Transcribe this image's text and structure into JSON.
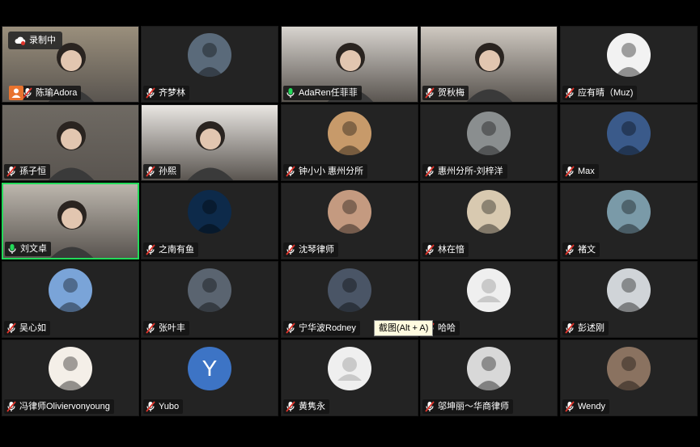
{
  "recording": {
    "label": "录制中"
  },
  "tooltip": {
    "label": "截图(Alt + A)"
  },
  "participants": [
    {
      "name": "陈瑜Adora",
      "muted": true,
      "video": true,
      "bg": "#9a8f7c"
    },
    {
      "name": "齐梦林",
      "muted": true,
      "video": false,
      "avatar_color": "#5a6a7a"
    },
    {
      "name": "AdaRen任菲菲",
      "muted": false,
      "video": true,
      "bg": "#d8d4cf"
    },
    {
      "name": "贺秋梅",
      "muted": true,
      "video": true,
      "bg": "#cfc9c1"
    },
    {
      "name": "应有晴（Muz)",
      "muted": true,
      "video": false,
      "avatar_color": "#f2f2f2"
    },
    {
      "name": "孫子恒",
      "muted": true,
      "video": true,
      "bg": "#6f6a63"
    },
    {
      "name": "孙熙",
      "muted": true,
      "video": true,
      "bg": "#e9e6e2"
    },
    {
      "name": "钟小小 惠州分所",
      "muted": true,
      "video": false,
      "avatar_color": "#c79a6a"
    },
    {
      "name": "惠州分所-刘梓洋",
      "muted": true,
      "video": false,
      "avatar_color": "#8a8e8f"
    },
    {
      "name": "Max",
      "muted": true,
      "video": false,
      "avatar_color": "#3a5a8a"
    },
    {
      "name": "刘文卓",
      "muted": false,
      "video": true,
      "bg": "#bcb6ad",
      "active": true
    },
    {
      "name": "之南有鱼",
      "muted": true,
      "video": false,
      "avatar_color": "#0d2a4a"
    },
    {
      "name": "沈琴律师",
      "muted": true,
      "video": false,
      "avatar_color": "#c49a80"
    },
    {
      "name": "林在愔",
      "muted": true,
      "video": false,
      "avatar_color": "#d8c9b0"
    },
    {
      "name": "褚文",
      "muted": true,
      "video": false,
      "avatar_color": "#7a9aa8"
    },
    {
      "name": "吴心如",
      "muted": true,
      "video": false,
      "avatar_color": "#7aa4d8"
    },
    {
      "name": "张叶丰",
      "muted": true,
      "video": false,
      "avatar_color": "#5a6470"
    },
    {
      "name": "宁华波Rodney",
      "muted": true,
      "video": false,
      "avatar_color": "#4a5566"
    },
    {
      "name": "哈哈",
      "muted": true,
      "video": false,
      "avatar_color": "blank"
    },
    {
      "name": "彭述刚",
      "muted": true,
      "video": false,
      "avatar_color": "#d0d4d8"
    },
    {
      "name": "冯律师Oliviervonyoung",
      "muted": true,
      "video": false,
      "avatar_color": "#f4efe8"
    },
    {
      "name": "Yubo",
      "muted": true,
      "video": false,
      "avatar_letter": "Y"
    },
    {
      "name": "黄隽永",
      "muted": true,
      "video": false,
      "avatar_color": "blank"
    },
    {
      "name": "邬坤丽～华商律师",
      "muted": true,
      "video": false,
      "avatar_color": "#d8d8d8"
    },
    {
      "name": "Wendy",
      "muted": true,
      "video": false,
      "avatar_color": "#8a7260"
    }
  ]
}
